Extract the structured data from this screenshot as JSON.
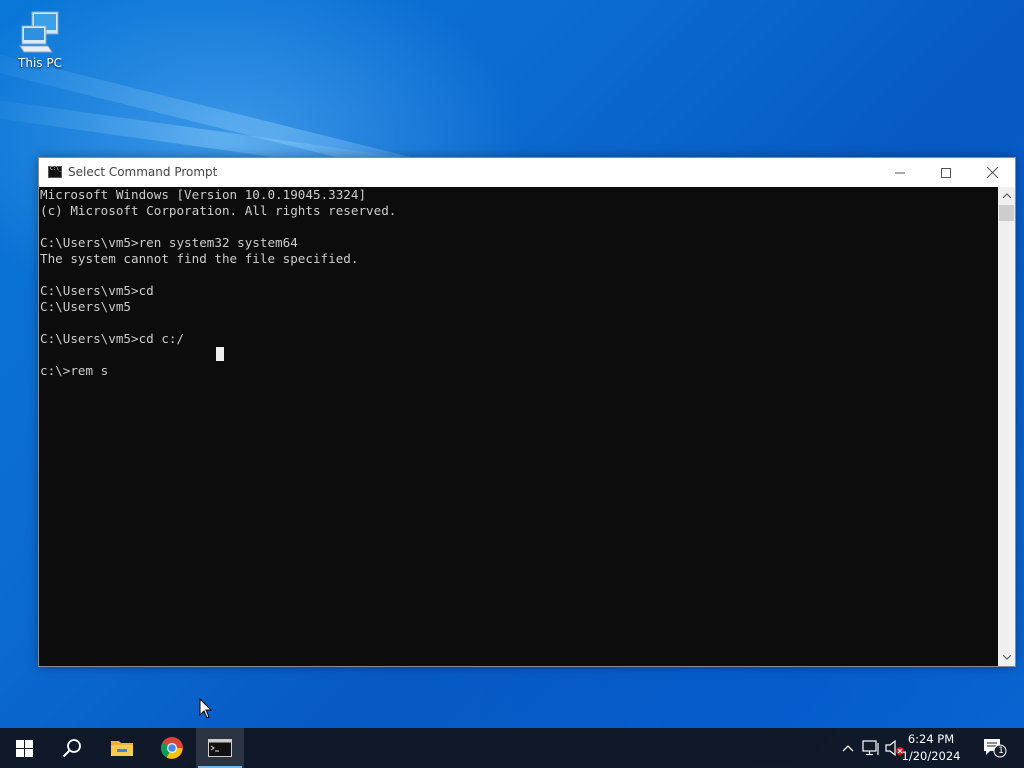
{
  "desktop": {
    "icons": [
      {
        "label": "This PC",
        "icon": "this-pc-icon"
      }
    ]
  },
  "window": {
    "title": "Select Command Prompt",
    "icon": "cmd-icon",
    "controls": {
      "minimize": "minimize-icon",
      "maximize": "maximize-icon",
      "close": "close-icon"
    }
  },
  "console": {
    "text": "Microsoft Windows [Version 10.0.19045.3324]\n(c) Microsoft Corporation. All rights reserved.\n\nC:\\Users\\vm5>ren system32 system64\nThe system cannot find the file specified.\n\nC:\\Users\\vm5>cd\nC:\\Users\\vm5\n\nC:\\Users\\vm5>cd c:/\n\nc:\\>rem s",
    "background": "#0c0c0c",
    "foreground": "#cccccc"
  },
  "taskbar": {
    "start": "windows-start-icon",
    "search": "search-icon",
    "pinned": [
      {
        "name": "File Explorer",
        "icon": "file-explorer-icon"
      },
      {
        "name": "Google Chrome",
        "icon": "chrome-icon"
      },
      {
        "name": "Command Prompt",
        "icon": "cmd-icon",
        "active": true
      }
    ],
    "tray": {
      "icons": [
        "chevron-up-icon",
        "network-icon",
        "volume-muted-icon"
      ],
      "time": "6:24 PM",
      "date": "1/20/2024",
      "notification_count": "1"
    }
  },
  "colors": {
    "desktop": "#0a6fd6",
    "taskbar": "#101622",
    "accent": "#76b9ed"
  }
}
